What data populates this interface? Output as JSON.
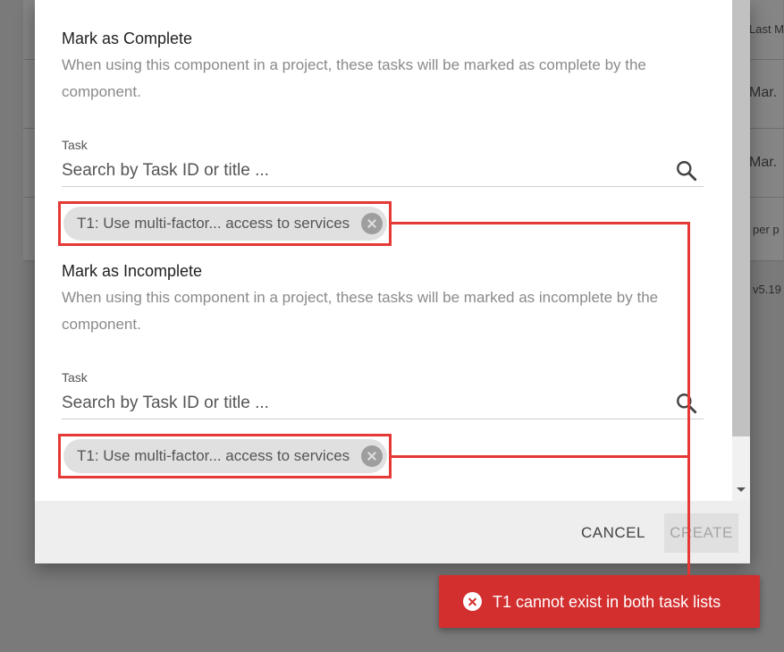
{
  "background": {
    "header_text": "Last M",
    "rows": [
      "Mar.",
      "Mar."
    ],
    "per_page_text": "per p",
    "version_text": "v5.19"
  },
  "dialog": {
    "complete": {
      "title": "Mark as Complete",
      "description": "When using this component in a project, these tasks will be marked as complete by the component.",
      "field_label": "Task",
      "placeholder": "Search by Task ID or title ...",
      "chip_label": "T1: Use multi-factor... access to services"
    },
    "incomplete": {
      "title": "Mark as Incomplete",
      "description": "When using this component in a project, these tasks will be marked as incomplete by the component.",
      "field_label": "Task",
      "placeholder": "Search by Task ID or title ...",
      "chip_label": "T1: Use multi-factor... access to services"
    },
    "footer": {
      "cancel_label": "CANCEL",
      "create_label": "CREATE"
    }
  },
  "toast": {
    "message": "T1 cannot exist in both task lists",
    "icon": "error-circle-icon"
  },
  "colors": {
    "highlight": "#e53935",
    "toast_bg": "#d32f2f"
  }
}
